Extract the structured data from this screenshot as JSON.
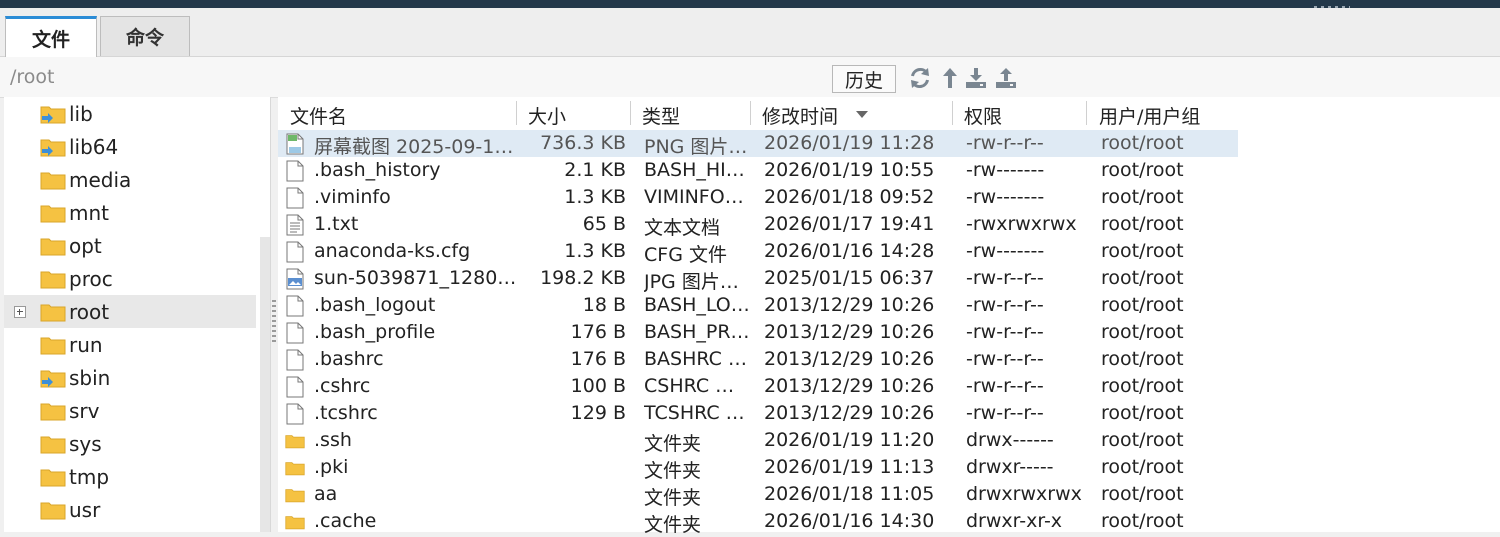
{
  "tabs": [
    {
      "label": "文件",
      "active": true
    },
    {
      "label": "命令",
      "active": false
    }
  ],
  "path": {
    "value": "/root"
  },
  "toolbar": {
    "history_label": "历史",
    "icons": [
      "refresh-icon",
      "up-arrow-icon",
      "download-icon",
      "upload-icon"
    ]
  },
  "tree": {
    "items": [
      {
        "label": "lib",
        "icon": "folder-link-icon",
        "selected": false,
        "expandable": false
      },
      {
        "label": "lib64",
        "icon": "folder-link-icon",
        "selected": false,
        "expandable": false
      },
      {
        "label": "media",
        "icon": "folder-icon",
        "selected": false,
        "expandable": false
      },
      {
        "label": "mnt",
        "icon": "folder-icon",
        "selected": false,
        "expandable": false
      },
      {
        "label": "opt",
        "icon": "folder-icon",
        "selected": false,
        "expandable": false
      },
      {
        "label": "proc",
        "icon": "folder-icon",
        "selected": false,
        "expandable": false
      },
      {
        "label": "root",
        "icon": "folder-icon",
        "selected": true,
        "expandable": true
      },
      {
        "label": "run",
        "icon": "folder-icon",
        "selected": false,
        "expandable": false
      },
      {
        "label": "sbin",
        "icon": "folder-link-icon",
        "selected": false,
        "expandable": false
      },
      {
        "label": "srv",
        "icon": "folder-icon",
        "selected": false,
        "expandable": false
      },
      {
        "label": "sys",
        "icon": "folder-icon",
        "selected": false,
        "expandable": false
      },
      {
        "label": "tmp",
        "icon": "folder-icon",
        "selected": false,
        "expandable": false
      },
      {
        "label": "usr",
        "icon": "folder-icon",
        "selected": false,
        "expandable": false
      }
    ]
  },
  "list": {
    "columns": [
      "文件名",
      "大小",
      "类型",
      "修改时间",
      "权限",
      "用户/用户组"
    ],
    "sort_column": "修改时间",
    "rows": [
      {
        "name": "屏幕截图 2025-09-1…",
        "size": "736.3 KB",
        "type": "PNG 图片…",
        "mtime": "2026/01/19 11:28",
        "perm": "-rw-r--r--",
        "owner": "root/root",
        "icon": "image-file-icon",
        "selected": true
      },
      {
        "name": ".bash_history",
        "size": "2.1 KB",
        "type": "BASH_HI…",
        "mtime": "2026/01/19 10:55",
        "perm": "-rw-------",
        "owner": "root/root",
        "icon": "file-icon",
        "selected": false
      },
      {
        "name": ".viminfo",
        "size": "1.3 KB",
        "type": "VIMINFO…",
        "mtime": "2026/01/18 09:52",
        "perm": "-rw-------",
        "owner": "root/root",
        "icon": "file-icon",
        "selected": false
      },
      {
        "name": "1.txt",
        "size": "65 B",
        "type": "文本文档",
        "mtime": "2026/01/17 19:41",
        "perm": "-rwxrwxrwx",
        "owner": "root/root",
        "icon": "text-file-icon",
        "selected": false
      },
      {
        "name": "anaconda-ks.cfg",
        "size": "1.3 KB",
        "type": "CFG 文件",
        "mtime": "2026/01/16 14:28",
        "perm": "-rw-------",
        "owner": "root/root",
        "icon": "file-icon",
        "selected": false
      },
      {
        "name": "sun-5039871_1280…",
        "size": "198.2 KB",
        "type": "JPG 图片…",
        "mtime": "2025/01/15 06:37",
        "perm": "-rw-r--r--",
        "owner": "root/root",
        "icon": "jpg-file-icon",
        "selected": false
      },
      {
        "name": ".bash_logout",
        "size": "18 B",
        "type": "BASH_LO…",
        "mtime": "2013/12/29 10:26",
        "perm": "-rw-r--r--",
        "owner": "root/root",
        "icon": "file-icon",
        "selected": false
      },
      {
        "name": ".bash_profile",
        "size": "176 B",
        "type": "BASH_PR…",
        "mtime": "2013/12/29 10:26",
        "perm": "-rw-r--r--",
        "owner": "root/root",
        "icon": "file-icon",
        "selected": false
      },
      {
        "name": ".bashrc",
        "size": "176 B",
        "type": "BASHRC …",
        "mtime": "2013/12/29 10:26",
        "perm": "-rw-r--r--",
        "owner": "root/root",
        "icon": "file-icon",
        "selected": false
      },
      {
        "name": ".cshrc",
        "size": "100 B",
        "type": "CSHRC …",
        "mtime": "2013/12/29 10:26",
        "perm": "-rw-r--r--",
        "owner": "root/root",
        "icon": "file-icon",
        "selected": false
      },
      {
        "name": ".tcshrc",
        "size": "129 B",
        "type": "TCSHRC …",
        "mtime": "2013/12/29 10:26",
        "perm": "-rw-r--r--",
        "owner": "root/root",
        "icon": "file-icon",
        "selected": false
      },
      {
        "name": ".ssh",
        "size": "",
        "type": "文件夹",
        "mtime": "2026/01/19 11:20",
        "perm": "drwx------",
        "owner": "root/root",
        "icon": "folder-icon",
        "selected": false
      },
      {
        "name": ".pki",
        "size": "",
        "type": "文件夹",
        "mtime": "2026/01/19 11:13",
        "perm": "drwxr-----",
        "owner": "root/root",
        "icon": "folder-icon",
        "selected": false
      },
      {
        "name": "aa",
        "size": "",
        "type": "文件夹",
        "mtime": "2026/01/18 11:05",
        "perm": "drwxrwxrwx",
        "owner": "root/root",
        "icon": "folder-icon",
        "selected": false
      },
      {
        "name": ".cache",
        "size": "",
        "type": "文件夹",
        "mtime": "2026/01/16 14:30",
        "perm": "drwxr-xr-x",
        "owner": "root/root",
        "icon": "folder-icon",
        "selected": false
      }
    ]
  },
  "colors": {
    "accent": "#2b8cd6",
    "selection": "#dfeaf4",
    "folder": "#f5c242",
    "topbar": "#23384a"
  }
}
